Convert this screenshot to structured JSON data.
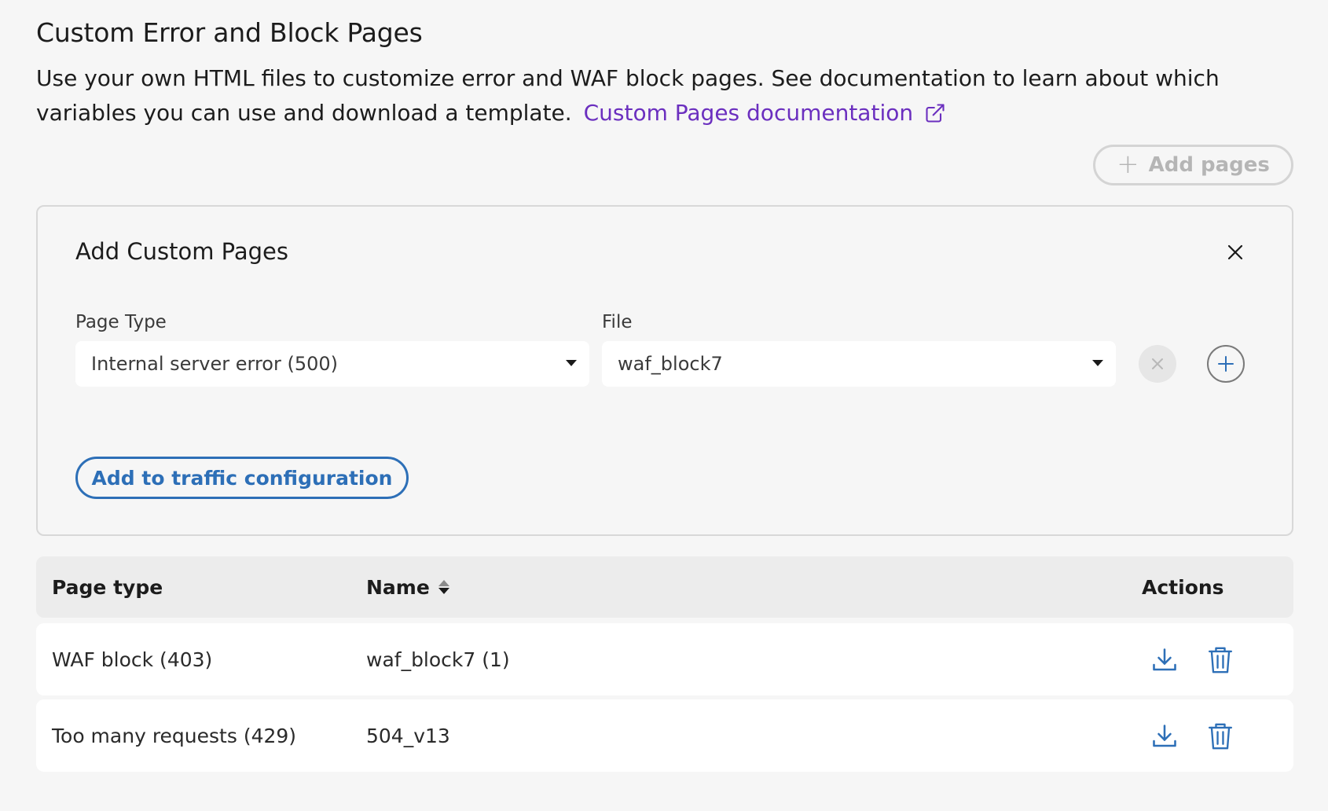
{
  "page": {
    "title": "Custom Error and Block Pages",
    "intro_text": "Use your own HTML files to customize error and WAF block pages. See documentation to learn about which variables you can use and download a template.",
    "doc_link_label": "Custom Pages documentation",
    "add_pages_label": "Add pages",
    "add_pages_disabled": true
  },
  "panel": {
    "title": "Add Custom Pages",
    "page_type_label": "Page Type",
    "page_type_value": "Internal server error (500)",
    "file_label": "File",
    "file_value": "waf_block7",
    "submit_label": "Add to traffic configuration"
  },
  "table": {
    "headers": {
      "page_type": "Page type",
      "name": "Name",
      "actions": "Actions"
    },
    "rows": [
      {
        "page_type": "WAF block (403)",
        "name": "waf_block7 (1)"
      },
      {
        "page_type": "Too many requests (429)",
        "name": "504_v13"
      }
    ]
  },
  "icons": {
    "external_link": "external-link-icon",
    "plus": "plus-icon",
    "close": "close-icon",
    "caret": "caret-down-icon",
    "sort": "sort-icon",
    "download": "download-icon",
    "trash": "trash-icon"
  },
  "colors": {
    "link": "#6b2fbf",
    "primary": "#2d6fb7",
    "disabled": "#b5b5b5",
    "background": "#f6f6f6"
  }
}
